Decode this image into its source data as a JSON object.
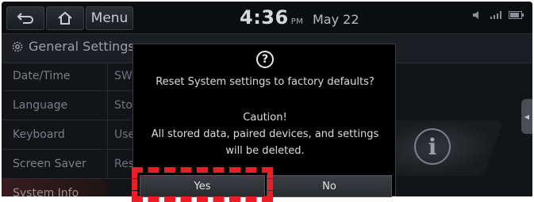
{
  "topbar": {
    "back_icon": "back-arrow-icon",
    "home_icon": "home-icon",
    "menu_label": "Menu",
    "time": "4:36",
    "ampm": "PM",
    "date": "May 22",
    "status_icons": [
      "audio-icon",
      "signal-icon",
      "battery-icon"
    ]
  },
  "header": {
    "icon": "gear-icon",
    "title": "General Settings"
  },
  "categories": [
    {
      "label": "Date/Time"
    },
    {
      "label": "Language"
    },
    {
      "label": "Keyboard"
    },
    {
      "label": "Screen Saver"
    },
    {
      "label": "System Info"
    }
  ],
  "sub_items": [
    {
      "label": "SW"
    },
    {
      "label": "Sto"
    },
    {
      "label": "Use"
    },
    {
      "label": "Res"
    }
  ],
  "dialog": {
    "icon": "question-icon",
    "icon_glyph": "?",
    "message": "Reset System settings to factory defaults?",
    "caution": "Caution!",
    "warning_line1": "All stored data, paired devices, and settings",
    "warning_line2": "will be deleted.",
    "yes_label": "Yes",
    "no_label": "No"
  },
  "colors": {
    "highlight": "#ee1c25",
    "background": "#121417"
  }
}
